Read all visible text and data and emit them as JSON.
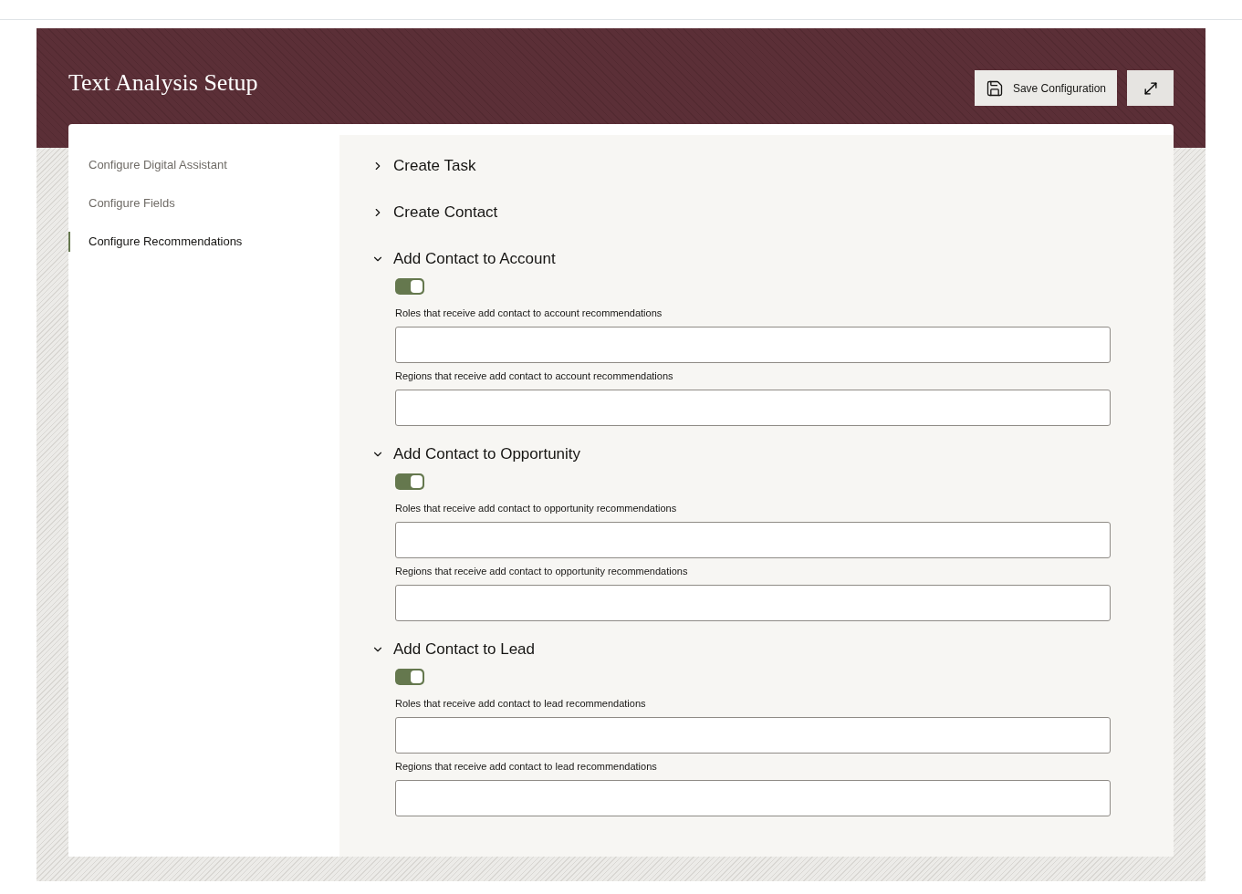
{
  "header": {
    "title": "Text Analysis Setup",
    "save_button": "Save Configuration"
  },
  "sidebar": {
    "items": [
      {
        "label": "Configure Digital Assistant",
        "selected": false
      },
      {
        "label": "Configure Fields",
        "selected": false
      },
      {
        "label": "Configure Recommendations",
        "selected": true
      }
    ]
  },
  "sections": [
    {
      "title": "Create Task",
      "expanded": false
    },
    {
      "title": "Create Contact",
      "expanded": false
    },
    {
      "title": "Add Contact to Account",
      "expanded": true,
      "enabled": true,
      "fields": [
        {
          "label": "Roles that receive add contact to account recommendations"
        },
        {
          "label": "Regions that receive add contact to account recommendations"
        }
      ]
    },
    {
      "title": "Add Contact to Opportunity",
      "expanded": true,
      "enabled": true,
      "fields": [
        {
          "label": "Roles that receive add contact to opportunity recommendations"
        },
        {
          "label": "Regions that receive add contact to opportunity recommendations"
        }
      ]
    },
    {
      "title": "Add Contact to Lead",
      "expanded": true,
      "enabled": true,
      "fields": [
        {
          "label": "Roles that receive add contact to lead recommendations"
        },
        {
          "label": "Regions that receive add contact to lead recommendations"
        }
      ]
    }
  ]
}
